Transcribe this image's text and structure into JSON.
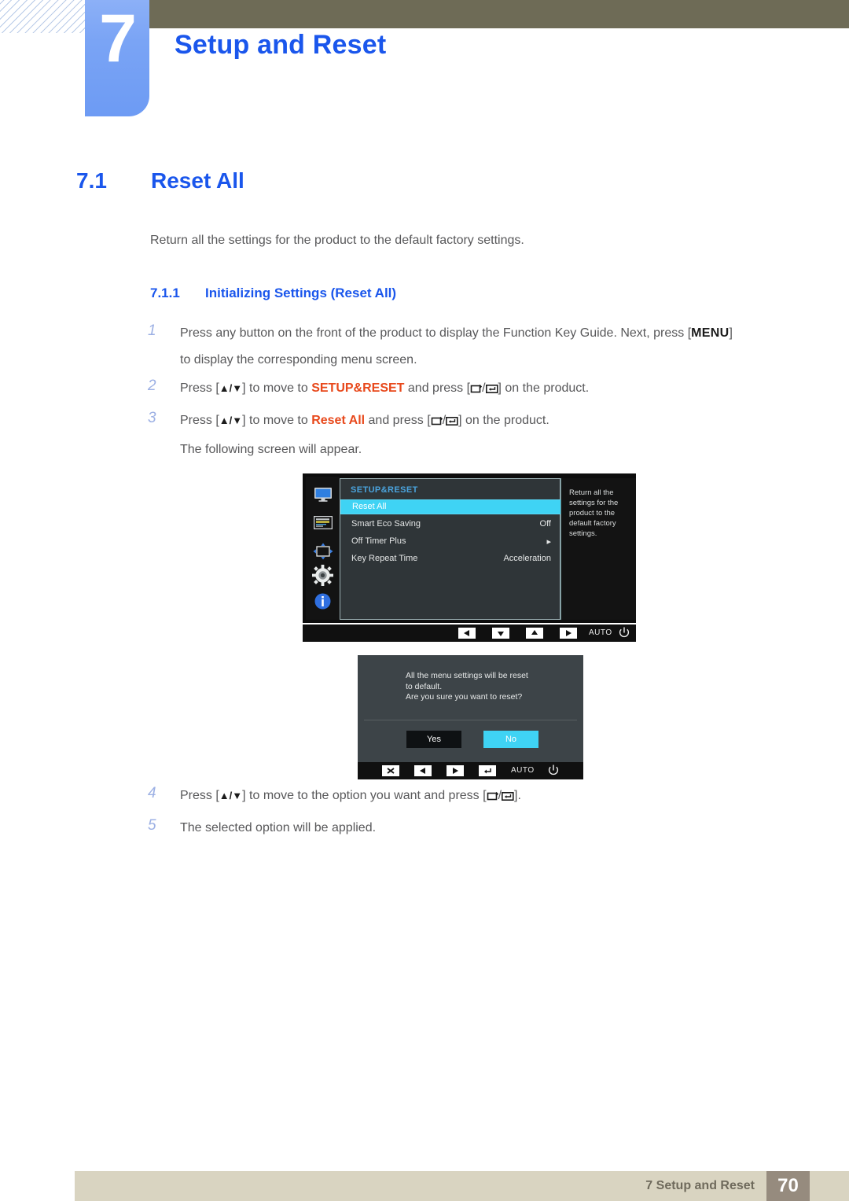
{
  "header": {
    "chapter_number": "7",
    "chapter_title": "Setup and Reset"
  },
  "section": {
    "number": "7.1",
    "title": "Reset All",
    "lead": "Return all the settings for the product to the default factory settings.",
    "sub_number": "7.1.1",
    "sub_title": "Initializing Settings (Reset All)"
  },
  "steps": [
    {
      "n": "1",
      "pre": "Press any button on the front of the product to display the Function Key Guide. Next, press [",
      "key": "MENU",
      "post": "]",
      "cont": "to display the corresponding menu screen."
    },
    {
      "n": "2",
      "p1": "Press [",
      "arrows": "▲/▼",
      "p2": "] to move to ",
      "highlight": "SETUP&RESET",
      "p3": " and press [",
      "p4": "] on the product."
    },
    {
      "n": "3",
      "p1": "Press [",
      "arrows": "▲/▼",
      "p2": "] to move to ",
      "highlight": "Reset All",
      "p3": " and press [",
      "p4": "] on the product.",
      "cont": "The following screen will appear."
    }
  ],
  "steps_after": [
    {
      "n": "4",
      "p1": "Press [",
      "arrows": "▲/▼",
      "p2": "] to move to the option you want and press [",
      "p4": "]."
    },
    {
      "n": "5",
      "text": "The selected option will be applied."
    }
  ],
  "osd_menu": {
    "title": "SETUP&RESET",
    "icons": [
      "monitor-icon",
      "picture-settings-icon",
      "screen-adjust-icon",
      "gear-icon",
      "information-icon"
    ],
    "rows": [
      {
        "label": "Reset All",
        "value": "",
        "selected": true
      },
      {
        "label": "Smart Eco Saving",
        "value": "Off",
        "selected": false
      },
      {
        "label": "Off Timer Plus",
        "value": "▸",
        "selected": false
      },
      {
        "label": "Key Repeat Time",
        "value": "Acceleration",
        "selected": false
      }
    ],
    "description": "Return all the settings for the product to the default factory settings.",
    "keybar": [
      "left-icon",
      "down-icon",
      "up-icon",
      "right-icon",
      "AUTO",
      "power-icon"
    ],
    "auto_label": "AUTO",
    "highlight_color": "#3fd3f4",
    "title_color": "#4aa3dd"
  },
  "osd_dialog": {
    "message_line1": "All the menu settings will be reset",
    "message_line2": "to default.",
    "message_line3": "Are you sure you want to reset?",
    "yes_label": "Yes",
    "no_label": "No",
    "selected_button": "No",
    "keybar": [
      "close-icon",
      "left-icon",
      "right-icon",
      "enter-icon",
      "AUTO",
      "power-icon"
    ],
    "auto_label": "AUTO"
  },
  "footer": {
    "text": "7 Setup and Reset",
    "page": "70"
  }
}
